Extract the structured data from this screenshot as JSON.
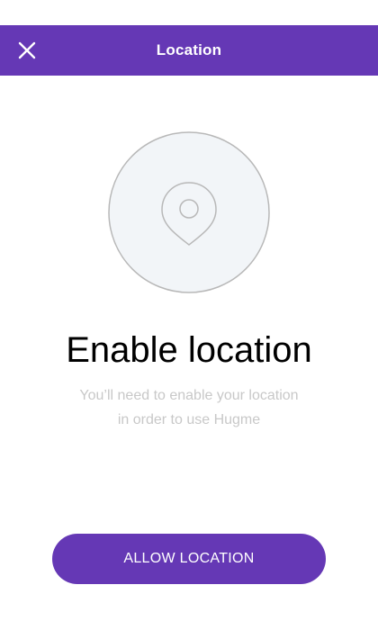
{
  "header": {
    "title": "Location",
    "close_icon": "close-icon",
    "background": "#6538b5"
  },
  "illustration": {
    "icon": "map-pin-icon"
  },
  "main": {
    "heading": "Enable location",
    "description_line1": "You’ll need to enable your location",
    "description_line2": "in order to use Hugme"
  },
  "actions": {
    "allow_label": "ALLOW LOCATION",
    "accent": "#6538b5"
  }
}
